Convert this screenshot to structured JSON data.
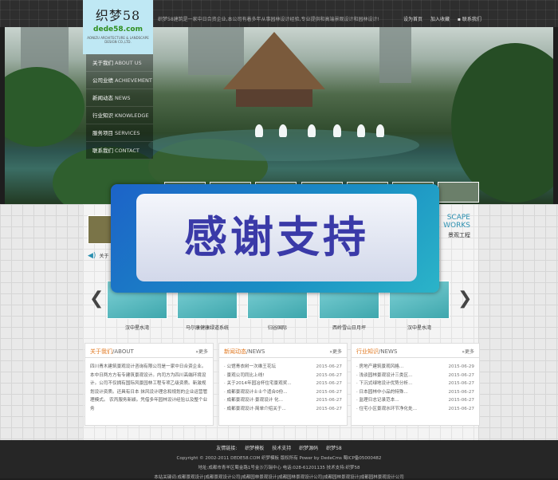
{
  "header": {
    "logo_cn": "织梦58",
    "logo_domain": "dede58.com",
    "logo_sub": "AONIZU ARCHITECTURE & LANDSCAPE DESIGN CO.,LTD.",
    "intro": "织梦58建筑是一家中日合资企业,本公司有着多年从事园林设计经验,专业提供和高端景观设计和园林设计!",
    "links": [
      "设为首页",
      "加入收藏",
      "联系我们"
    ]
  },
  "nav": [
    {
      "cn": "关于我们",
      "en": "ABOUT US"
    },
    {
      "cn": "公司业绩",
      "en": "ACHIEVEMENT"
    },
    {
      "cn": "新闻动态",
      "en": "NEWS"
    },
    {
      "cn": "行业知识",
      "en": "KNOWLEDGE"
    },
    {
      "cn": "服务项目",
      "en": "SERVICES"
    },
    {
      "cn": "联系我们",
      "en": "CONTACT"
    }
  ],
  "overlay_text": "感谢支持",
  "cases": {
    "scape": "SCAPE",
    "works": "WORKS",
    "label": "景观工程",
    "notice": "关于"
  },
  "projects": [
    "汉中星水湾",
    "马尔康健康绿道系统",
    "归谷国际",
    "西岭雪山日月坪",
    "汉中星水湾"
  ],
  "panels": {
    "about": {
      "title_cn": "关于我们",
      "title_en": "/ABOUT",
      "more": "更多",
      "text": "四川青木建筑景观设计咨询有限公司是一家中日合资企业。本中日两方方有专建筑景观设计。内司方为四川高端环境设计。公司不仅拥有国际风景园林工程专项乙级资质。新激规划设计资质。还具有日本 抹风设计理念和规划的企业运营管理模式。 农丙服务新颖。凭借多年园林设计经验以及整个业务"
    },
    "news": {
      "title_cn": "新闻动态",
      "title_en": "/NEWS",
      "more": "更多",
      "rows": [
        {
          "t": "· 公馆青衣树一次维王花坛",
          "d": "2015-06-27"
        },
        {
          "t": "· 景观公司同比上线!",
          "d": "2015-06-27"
        },
        {
          "t": "· 关于2014年园冶杯住宅景观奖...",
          "d": "2015-06-27"
        },
        {
          "t": "· 成都景观设计士士个适合0份...",
          "d": "2015-06-27"
        },
        {
          "t": "· 成都景观设计·景观设计 化...",
          "d": "2015-06-27"
        },
        {
          "t": "· 成都景观设计·简单介绍关于...",
          "d": "2015-06-27"
        }
      ]
    },
    "knowledge": {
      "title_cn": "行业知识",
      "title_en": "/NEWS",
      "more": "更多",
      "rows": [
        {
          "t": "· 房地产建筑景观风格...",
          "d": "2015-06-29"
        },
        {
          "t": "· 浅谈园林景观设计三类区...",
          "d": "2015-06-27"
        },
        {
          "t": "· 下沉式绿地设计优势分析...",
          "d": "2015-06-27"
        },
        {
          "t": "· 日本园林中小品的特殊...",
          "d": "2015-06-27"
        },
        {
          "t": "· 监理日志记录范本...",
          "d": "2015-06-27"
        },
        {
          "t": "· 住宅小区景观水环节净化处...",
          "d": "2015-06-27"
        }
      ]
    }
  },
  "footer": {
    "links_label": "友情链接:",
    "links": [
      "织梦模板",
      "技术支持",
      "织梦源码",
      "织梦58"
    ],
    "copyright": "Copyright © 2002-2011 DEDE58.COM 织梦模板 版权所有 Power by DedeCms 蜀ICP备05000482",
    "address": "地址:成都市青羊区蜀金路1号金沙万瑞中心 电话:028-61201135 技术支持:织梦58",
    "keywords": "本站关键词:成都景观设计|成都景观设计公司|成都园林景观设计|成都园林景观设计公司|成都园林景观设计|成都园林景观设计公司"
  }
}
